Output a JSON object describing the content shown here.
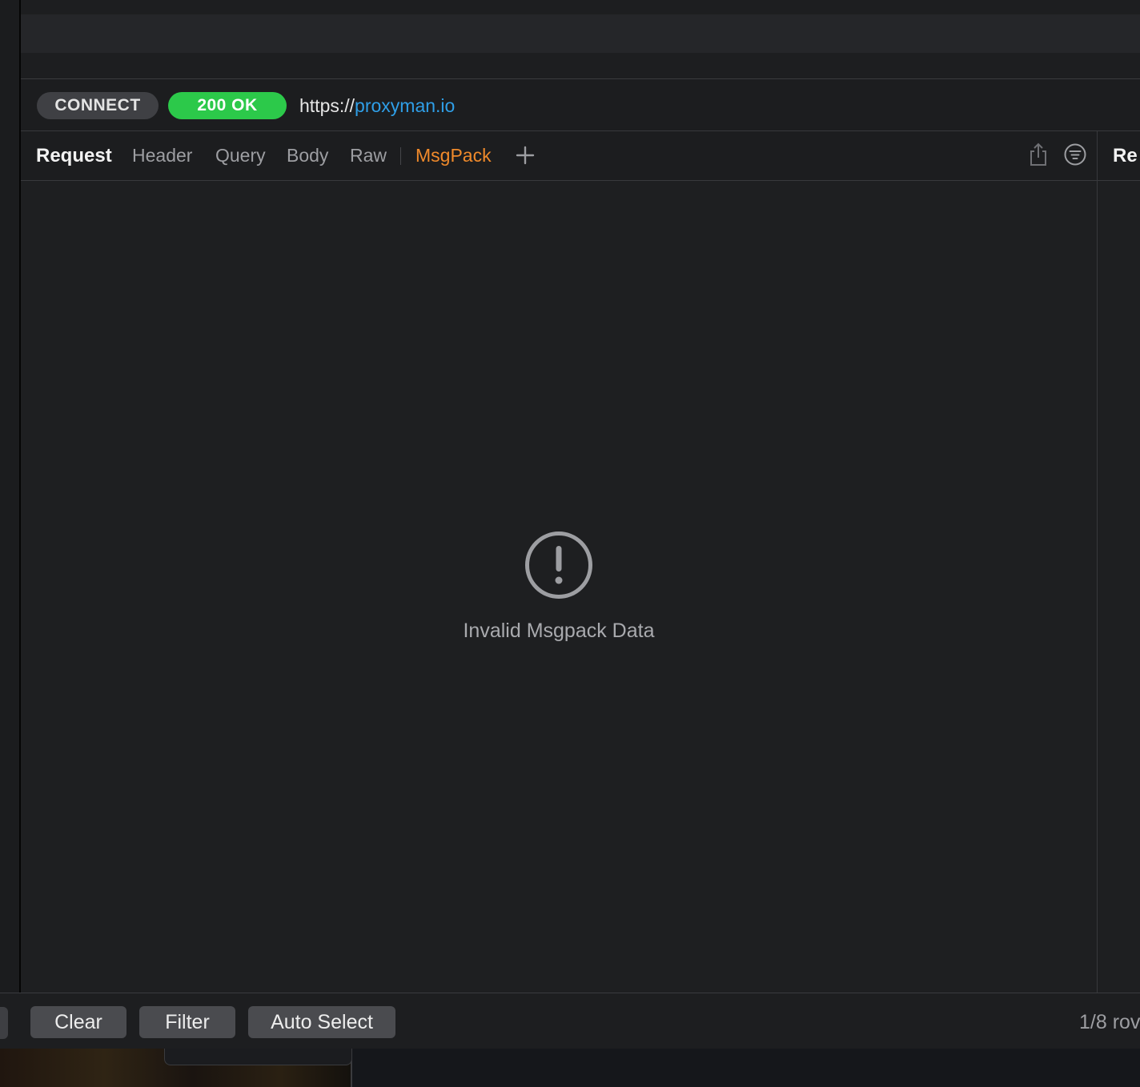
{
  "request": {
    "method": "CONNECT",
    "status": "200 OK",
    "url_scheme": "https://",
    "url_host": "proxyman.io"
  },
  "tabs": {
    "title": "Request",
    "items": [
      "Header",
      "Query",
      "Body",
      "Raw",
      "MsgPack"
    ],
    "active": "MsgPack"
  },
  "response_pane": {
    "title": "Re"
  },
  "content": {
    "message": "Invalid Msgpack Data"
  },
  "footer": {
    "clear_label": "Clear",
    "filter_label": "Filter",
    "auto_select_label": "Auto Select",
    "row_count": "1/8 rov"
  },
  "colors": {
    "accent_active_tab": "#f08a2b",
    "status_ok": "#2cc94a",
    "url_host": "#2f9fe8"
  },
  "icons": [
    "plus-icon",
    "share-icon",
    "filter-icon",
    "warning-icon"
  ]
}
